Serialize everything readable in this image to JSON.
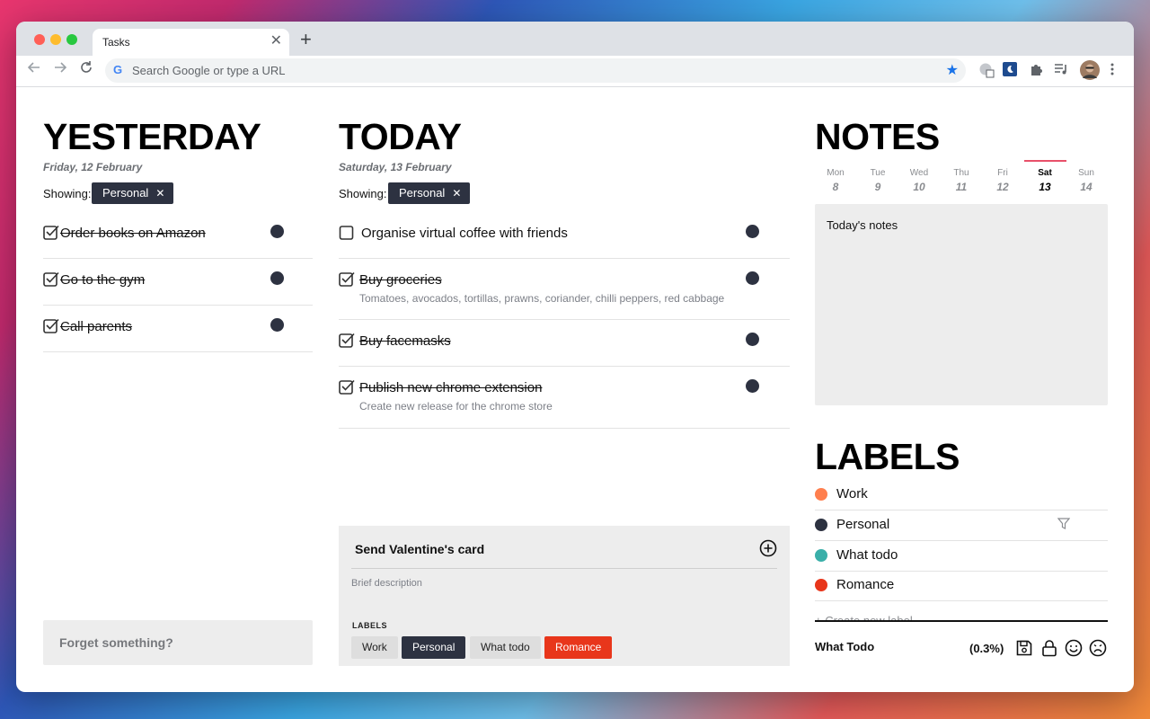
{
  "browser": {
    "tab_title": "Tasks",
    "tab_close": "✕",
    "new_tab": "+",
    "omnibox_placeholder": "Search Google or type a URL"
  },
  "yesterday": {
    "heading": "YESTERDAY",
    "date": "Friday, 12 February",
    "showing_label": "Showing:",
    "filter_chip": "Personal",
    "tasks": [
      {
        "title": "Order books on Amazon",
        "done": true
      },
      {
        "title": "Go to the gym",
        "done": true
      },
      {
        "title": "Call parents",
        "done": true
      }
    ],
    "forget_placeholder": "Forget something?"
  },
  "today": {
    "heading": "TODAY",
    "date": "Saturday, 13 February",
    "showing_label": "Showing:",
    "filter_chip": "Personal",
    "tasks": [
      {
        "title": "Organise virtual coffee with friends",
        "done": false,
        "description": ""
      },
      {
        "title": "Buy groceries",
        "done": true,
        "description": "Tomatoes, avocados, tortillas, prawns, coriander, chilli peppers, red cabbage"
      },
      {
        "title": "Buy facemasks",
        "done": true,
        "description": ""
      },
      {
        "title": "Publish new chrome extension",
        "done": true,
        "description": "Create new release for the chrome store"
      }
    ],
    "composer": {
      "title": "Send Valentine's card",
      "description_placeholder": "Brief description",
      "labels_heading": "LABELS",
      "labels": [
        "Work",
        "Personal",
        "What todo",
        "Romance"
      ]
    }
  },
  "notes": {
    "heading": "NOTES",
    "calendar": [
      {
        "day": "Mon",
        "num": "8"
      },
      {
        "day": "Tue",
        "num": "9"
      },
      {
        "day": "Wed",
        "num": "10"
      },
      {
        "day": "Thu",
        "num": "11"
      },
      {
        "day": "Fri",
        "num": "12"
      },
      {
        "day": "Sat",
        "num": "13"
      },
      {
        "day": "Sun",
        "num": "14"
      }
    ],
    "active_day": "Sat",
    "notes_text": "Today's notes"
  },
  "labels": {
    "heading": "LABELS",
    "items": [
      {
        "name": "Work",
        "color": "#ff7f4e"
      },
      {
        "name": "Personal",
        "color": "#2d3241"
      },
      {
        "name": "What todo",
        "color": "#3aafa9"
      },
      {
        "name": "Romance",
        "color": "#e8361b"
      }
    ],
    "create_label": "+ Create new label"
  },
  "footer": {
    "app_name": "What Todo",
    "progress": "(0.3%)"
  },
  "icons": {
    "back": "back-arrow-icon",
    "forward": "forward-arrow-icon",
    "reload": "reload-icon",
    "bookmark": "star-icon",
    "extensions": "puzzle-icon",
    "media": "media-queue-icon",
    "menu": "kebab-menu-icon",
    "save": "save-icon",
    "lock": "lock-icon",
    "happy": "smile-icon",
    "sad": "frown-icon",
    "filter": "filter-icon"
  }
}
